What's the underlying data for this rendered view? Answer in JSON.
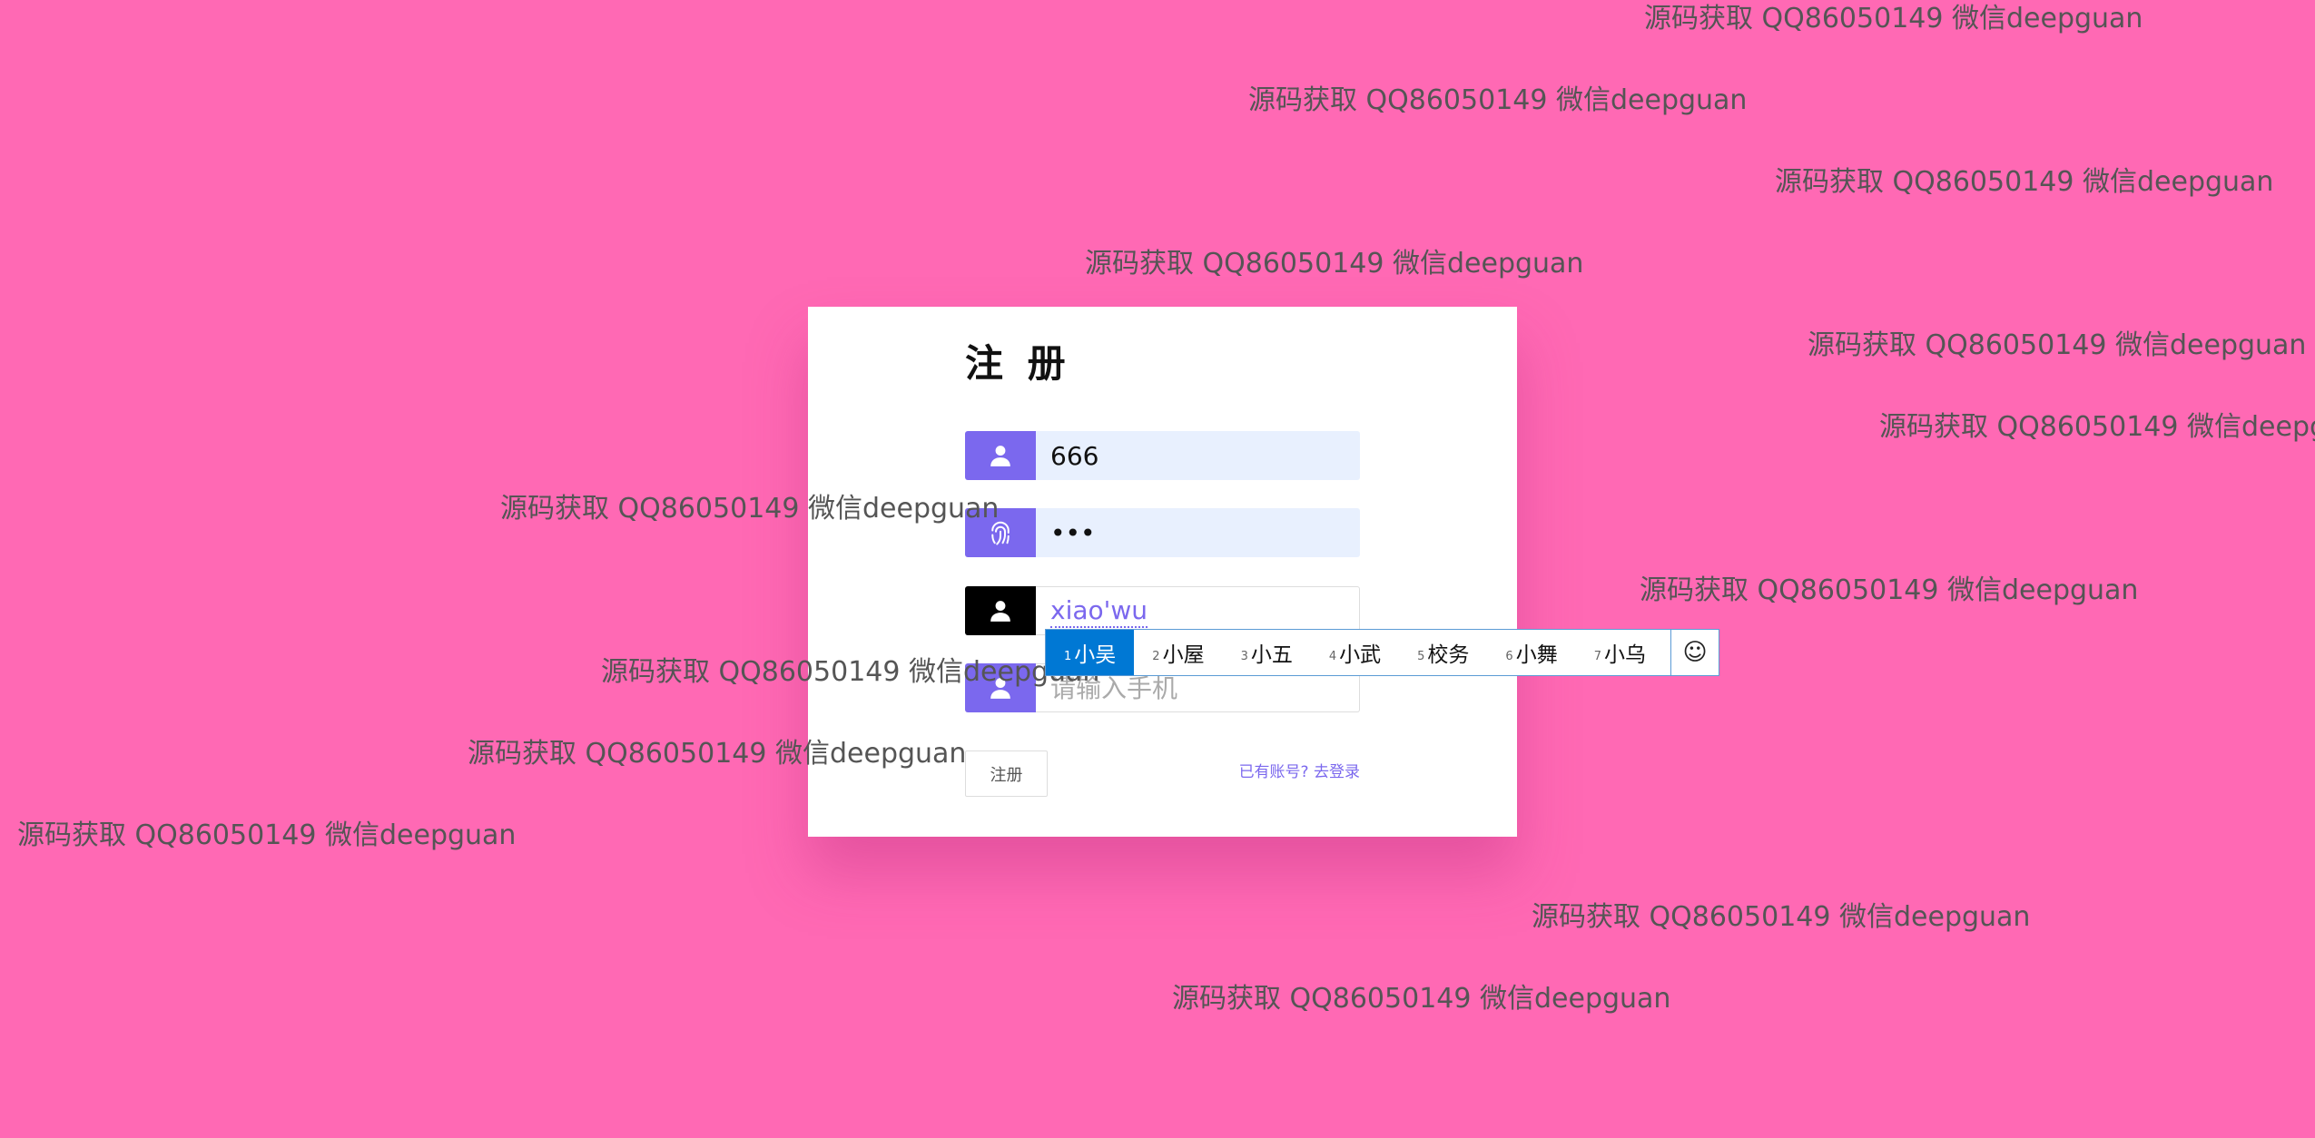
{
  "watermark_text": "源码获取 QQ86050149 微信deepguan",
  "form": {
    "title": "注 册",
    "username_value": "666",
    "password_value": "•••",
    "composition_text": "xiao'wu",
    "phone_placeholder": "请输入手机",
    "submit_label": "注册",
    "login_prompt": "已有账号?",
    "login_link": "去登录"
  },
  "ime": {
    "candidates": [
      {
        "num": "1",
        "text": "小吴"
      },
      {
        "num": "2",
        "text": "小屋"
      },
      {
        "num": "3",
        "text": "小五"
      },
      {
        "num": "4",
        "text": "小武"
      },
      {
        "num": "5",
        "text": "校务"
      },
      {
        "num": "6",
        "text": "小舞"
      },
      {
        "num": "7",
        "text": "小乌"
      }
    ],
    "emoji_icon": "smiley-icon"
  },
  "colors": {
    "background": "#ff69b4",
    "accent": "#7b68ee",
    "ime_selected": "#0078d4"
  }
}
